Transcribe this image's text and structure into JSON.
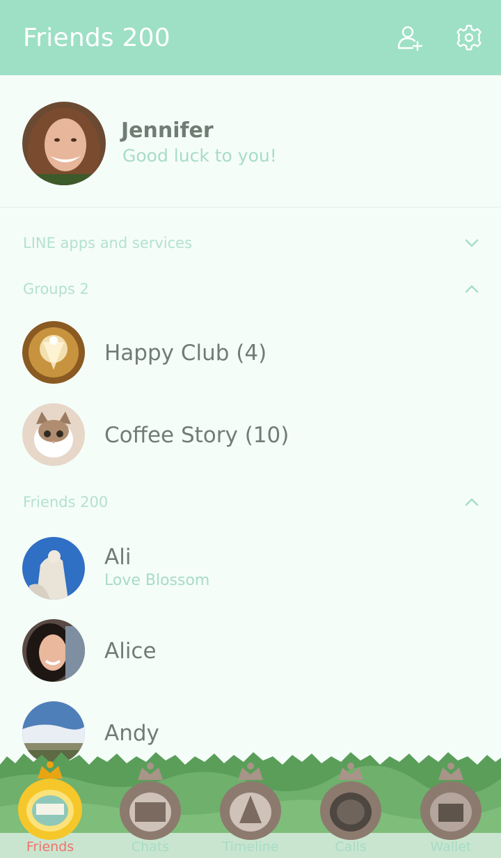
{
  "header": {
    "title": "Friends 200",
    "add_friend_icon": "add-friend-icon",
    "settings_icon": "gear-icon"
  },
  "profile": {
    "name": "Jennifer",
    "status": "Good luck to you!"
  },
  "sections": {
    "services": {
      "label": "LINE apps and services",
      "state": "collapsed"
    },
    "groups": {
      "label": "Groups 2",
      "state": "expanded"
    },
    "friends": {
      "label": "Friends 200",
      "state": "expanded"
    }
  },
  "groups": [
    {
      "name": "Happy Club (4)"
    },
    {
      "name": "Coffee Story (10)"
    }
  ],
  "friends": [
    {
      "name": "Ali",
      "status": "Love Blossom"
    },
    {
      "name": "Alice",
      "status": ""
    },
    {
      "name": "Andy",
      "status": ""
    }
  ],
  "tabs": [
    {
      "label": "Friends",
      "active": true
    },
    {
      "label": "Chats",
      "active": false
    },
    {
      "label": "Timeline",
      "active": false
    },
    {
      "label": "Calls",
      "active": false
    },
    {
      "label": "Wallet",
      "active": false
    }
  ],
  "colors": {
    "header_bg": "#9de0c6",
    "accent": "#a7dcc7",
    "text": "#6f7d74",
    "active_tab": "#f07268",
    "background": "#f5fdf9"
  }
}
